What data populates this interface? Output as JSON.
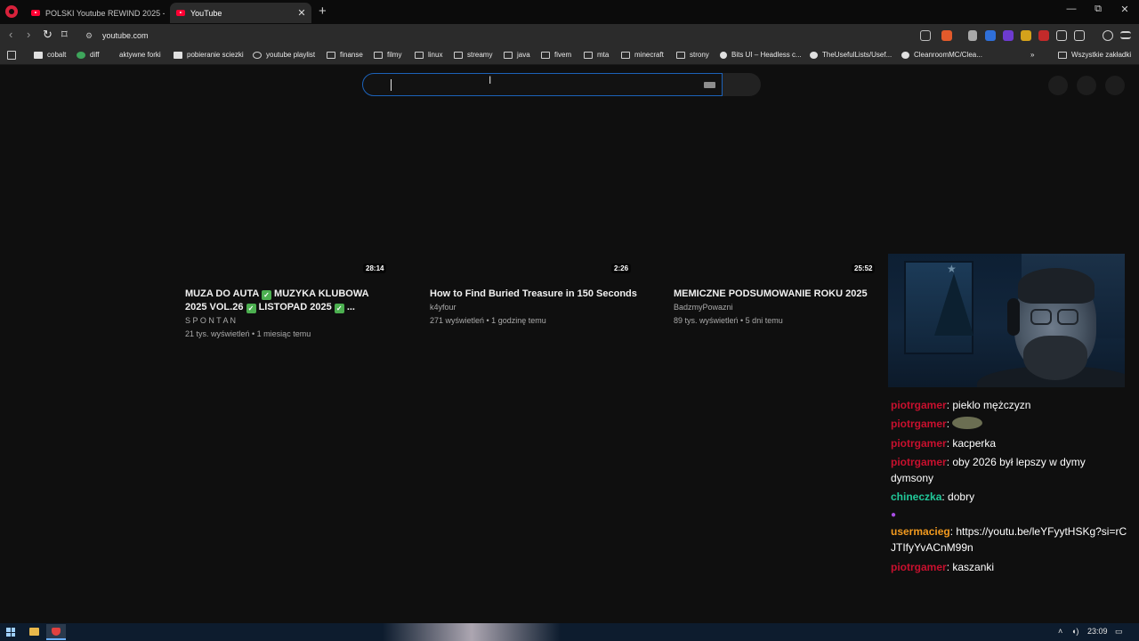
{
  "browser": {
    "tabs": [
      {
        "title": "POLSKI Youtube REWIND 2025 - You",
        "active": false
      },
      {
        "title": "YouTube",
        "active": true
      }
    ],
    "new_tab_label": "+",
    "window_controls": {
      "minimize": "—",
      "restore": "⧉",
      "close": "✕"
    },
    "nav": {
      "back": "‹",
      "forward": "›",
      "reload": "↻",
      "bookmark": "⌑"
    },
    "url": "youtube.com"
  },
  "bookmarks": {
    "items": [
      {
        "label": "cobalt",
        "icon": "cobalt-icon"
      },
      {
        "label": "diff",
        "icon": "diff-icon"
      },
      {
        "label": "aktywne forki",
        "icon": "fork-icon"
      },
      {
        "label": "pobieranie sciezki",
        "icon": "download-icon"
      },
      {
        "label": "youtube playlist",
        "icon": "globe-icon"
      },
      {
        "label": "finanse",
        "icon": "folder-icon"
      },
      {
        "label": "filmy",
        "icon": "folder-icon"
      },
      {
        "label": "linux",
        "icon": "folder-icon"
      },
      {
        "label": "streamy",
        "icon": "folder-icon"
      },
      {
        "label": "java",
        "icon": "folder-icon"
      },
      {
        "label": "fivem",
        "icon": "folder-icon"
      },
      {
        "label": "mta",
        "icon": "folder-icon"
      },
      {
        "label": "minecraft",
        "icon": "folder-icon"
      },
      {
        "label": "strony",
        "icon": "folder-icon"
      },
      {
        "label": "Bits UI – Headless c...",
        "icon": "bits-icon"
      },
      {
        "label": "TheUsefulLists/Usef...",
        "icon": "github-icon"
      },
      {
        "label": "CleanroomMC/Clea...",
        "icon": "github-icon"
      }
    ],
    "overflow": "»",
    "all_bookmarks": "Wszystkie zakładki"
  },
  "search": {
    "value": "",
    "placeholder": ""
  },
  "videos": [
    {
      "duration": "28:14",
      "title_line1": "MUZA DO AUTA",
      "title_line1b": "MUZYKA KLUBOWA",
      "title_line2a": "2025 VOL.26",
      "title_line2b": "LISTOPAD 2025",
      "title_line2c": "...",
      "channel": "S P O N T A N",
      "meta": "21 tys. wyświetleń • 1 miesiąc temu"
    },
    {
      "duration": "2:26",
      "title": "How to Find Buried Treasure in 150 Seconds",
      "channel": "k4yfour",
      "meta": "271 wyświetleń • 1 godzinę temu"
    },
    {
      "duration": "25:52",
      "title": "MEMICZNE PODSUMOWANIE ROKU 2025",
      "channel": "BadzmyPowazni",
      "meta": "89 tys. wyświetleń • 5 dni temu"
    }
  ],
  "chat": [
    {
      "user": "piotrgamer",
      "color": "#c8102e",
      "message": "pieklo mężczyzn"
    },
    {
      "user": "piotrgamer",
      "color": "#c8102e",
      "message": ""
    },
    {
      "user": "piotrgamer",
      "color": "#c8102e",
      "message": "kacperka"
    },
    {
      "user": "piotrgamer",
      "color": "#c8102e",
      "message": "oby 2026 był lepszy w dymy dymsony"
    },
    {
      "user": "chineczka",
      "color": "#21c99a",
      "message": "dobry"
    },
    {
      "user": "usermacieg",
      "color": "#f29a1f",
      "message": "https://youtu.be/leYFyytHSKg?si=rCJTIfyYvACnM99n"
    },
    {
      "user": "piotrgamer",
      "color": "#c8102e",
      "message": "kaszanki"
    }
  ],
  "taskbar": {
    "clock": "23:09"
  },
  "colors": {
    "accent": "#1c62b9",
    "youtube_red": "#ff0033",
    "background": "#0f0f0f"
  }
}
